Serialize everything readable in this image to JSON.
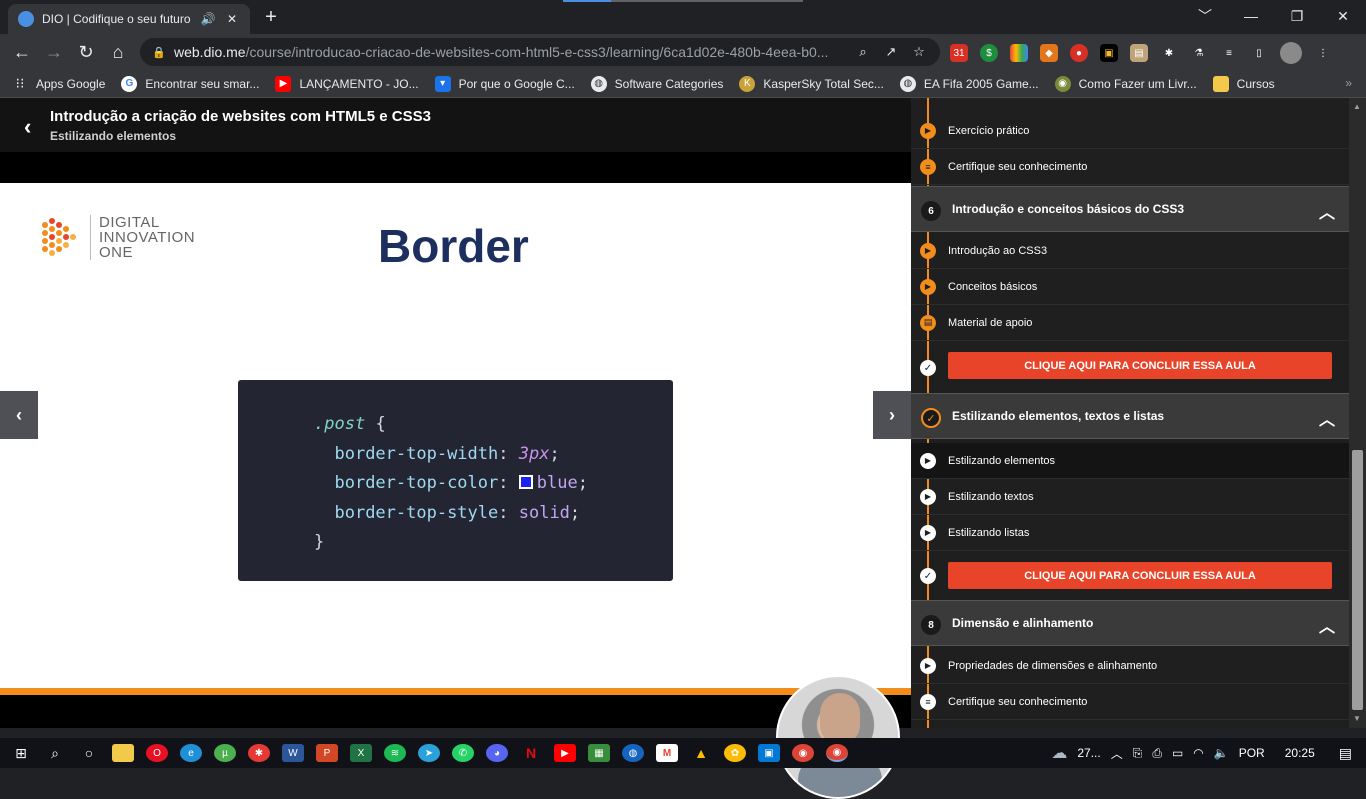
{
  "browser": {
    "tab_title": "DIO | Codifique o seu futuro",
    "url_host": "web.dio.me",
    "url_path": "/course/introducao-criacao-de-websites-com-html5-e-css3/learning/6ca1d02e-480b-4eea-b0...",
    "window_controls": [
      "﹀",
      "—",
      "❐",
      "✕"
    ]
  },
  "bookmarks": [
    {
      "label": "Apps Google",
      "icon": "apps-grid-icon",
      "color": "#202124"
    },
    {
      "label": "Encontrar seu smar...",
      "icon": "google-icon",
      "color": "#ffffff"
    },
    {
      "label": "LANÇAMENTO - JO...",
      "icon": "youtube-icon",
      "color": "#ff0000"
    },
    {
      "label": "Por que o Google C...",
      "icon": "bookmark-icon",
      "color": "#1a73e8"
    },
    {
      "label": "Software Categories",
      "icon": "globe-icon",
      "color": "#5f6368"
    },
    {
      "label": "KasperSky Total Sec...",
      "icon": "kaspersky-icon",
      "color": "#caa23a"
    },
    {
      "label": "EA Fifa 2005 Game...",
      "icon": "globe-icon",
      "color": "#5f6368"
    },
    {
      "label": "Como Fazer um Livr...",
      "icon": "site-icon",
      "color": "#7a8a3a"
    },
    {
      "label": "Cursos",
      "icon": "folder-icon",
      "color": "#f3c94b"
    }
  ],
  "course": {
    "title": "Introdução a criação de websites com HTML5 e CSS3",
    "subtitle": "Estilizando elementos"
  },
  "slide": {
    "logo_lines": [
      "DIGITAL",
      "INNOVATION",
      "ONE"
    ],
    "title": "Border",
    "code": {
      "selector": ".post",
      "open": "{",
      "close": "}",
      "lines": [
        {
          "prop": "border-top-width",
          "value": "3px"
        },
        {
          "prop": "border-top-color",
          "value": "blue"
        },
        {
          "prop": "border-top-style",
          "value": "solid"
        }
      ]
    },
    "swatch_color": "#1a23f0"
  },
  "sidebar": {
    "lessons_top": [
      {
        "label": "Exercício prático",
        "icon": "play-icon"
      },
      {
        "label": "Certifique seu conhecimento",
        "icon": "list-icon"
      }
    ],
    "modules": [
      {
        "number": "6",
        "title": "Introdução e conceitos básicos do CSS3",
        "lessons": [
          {
            "label": "Introdução ao CSS3",
            "icon": "play-icon"
          },
          {
            "label": "Conceitos básicos",
            "icon": "play-icon"
          },
          {
            "label": "Material de apoio",
            "icon": "document-icon"
          }
        ],
        "conclude_label": "CLIQUE AQUI PARA CONCLUIR ESSA AULA"
      },
      {
        "number": "",
        "title": "Estilizando elementos, textos e listas",
        "lessons": [
          {
            "label": "Estilizando elementos",
            "icon": "play-icon",
            "active": true
          },
          {
            "label": "Estilizando textos",
            "icon": "play-icon"
          },
          {
            "label": "Estilizando listas",
            "icon": "play-icon"
          }
        ],
        "conclude_label": "CLIQUE AQUI PARA CONCLUIR ESSA AULA"
      },
      {
        "number": "8",
        "title": "Dimensão e alinhamento",
        "lessons": [
          {
            "label": "Propriedades de dimensões e alinhamento",
            "icon": "play-icon"
          },
          {
            "label": "Certifique seu conhecimento",
            "icon": "list-icon"
          }
        ]
      }
    ]
  },
  "taskbar": {
    "weather": "27...",
    "language": "POR",
    "time": "20:25"
  },
  "colors": {
    "accent_orange": "#f28c1b",
    "conclude_red": "#e8442a",
    "title_navy": "#1c2f5f"
  }
}
